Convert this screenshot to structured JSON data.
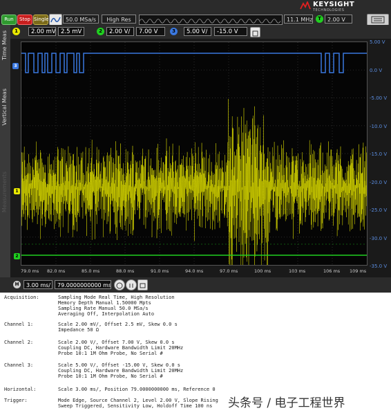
{
  "toolbar": {
    "run_label": "Run",
    "stop_label": "Stop",
    "single_label": "Single",
    "sample_rate": "50.0 MSa/s",
    "acq_mode": "High Res",
    "freq": "11.1 MHz",
    "trigger_level": "2.00 V",
    "brand": "KEYSIGHT",
    "brand_sub": "TECHNOLOGIES"
  },
  "channels": [
    {
      "id": "1",
      "scale": "2.00 mV/",
      "offset": "2.5 mV",
      "color": "#e8e800"
    },
    {
      "id": "2",
      "scale": "2.00 V/",
      "offset": "7.00 V",
      "color": "#20d020"
    },
    {
      "id": "3",
      "scale": "5.00 V/",
      "offset": "-15.0 V",
      "color": "#3a78e0"
    }
  ],
  "sidebar": {
    "time_meas": "Time Meas",
    "vertical_meas": "Vertical Meas",
    "measurements": "Measurements"
  },
  "y_axis_labels": [
    "5.00 V",
    "0.0 V",
    "-5.00 V",
    "-10.0 V",
    "-15.0 V",
    "-20.0 V",
    "-25.0 V",
    "-30.0 V",
    "-35.0 V"
  ],
  "x_axis_labels": [
    "79.0 ms",
    "82.0 ms",
    "85.0 ms",
    "88.0 ms",
    "91.0 ms",
    "94.0 ms",
    "97.0 ms",
    "100 ms",
    "103 ms",
    "106 ms",
    "109 ms"
  ],
  "horizontal": {
    "label": "H",
    "scale": "3.00 ms/",
    "position": "79.0000000000 ms"
  },
  "info": {
    "acquisition_label": "Acquisition:",
    "acquisition": [
      "Sampling Mode Real Time, High Resolution",
      "Memory Depth Manual 1.50000 Mpts",
      "Sampling Rate Manual 50.0 MSa/s",
      "Averaging Off, Interpolation Auto"
    ],
    "ch1_label": "Channel 1:",
    "ch1": [
      "Scale 2.00 mV/, Offset 2.5 mV, Skew 0.0 s",
      "Impedance 50 Ω"
    ],
    "ch2_label": "Channel 2:",
    "ch2": [
      "Scale 2.00 V/, Offset 7.00 V, Skew 0.0 s",
      "Coupling DC, Hardware Bandwidth Limit 20MHz",
      "Probe 10:1 1M Ohm Probe, No Serial #"
    ],
    "ch3_label": "Channel 3:",
    "ch3": [
      "Scale 5.00 V/, Offset -15.00 V, Skew 0.0 s",
      "Coupling DC, Hardware Bandwidth Limit 20MHz",
      "Probe 10:1 1M Ohm Probe, No Serial #"
    ],
    "horizontal_label": "Horizontal:",
    "horizontal": [
      "Scale 3.00 ms/, Position 79.0000000000 ms, Reference 0"
    ],
    "trigger_label": "Trigger:",
    "trigger": [
      "Mode Edge, Source Channel 2, Level 2.00 V, Slope Rising",
      "Sweep Triggered, Sensitivity Low, Holdoff Time 100 ns"
    ]
  },
  "watermark": "头条号 / 电子工程世界"
}
